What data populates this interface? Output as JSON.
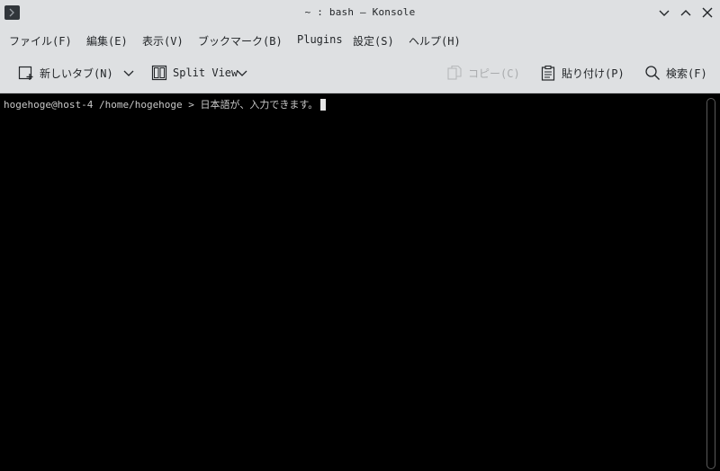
{
  "window": {
    "title": "~ : bash — Konsole",
    "app_icon": "terminal-icon",
    "controls": [
      "minimize-icon",
      "maximize-icon",
      "close-icon"
    ]
  },
  "menubar": {
    "items": [
      {
        "label": "ファイル(F)"
      },
      {
        "label": "編集(E)"
      },
      {
        "label": "表示(V)"
      },
      {
        "label": "ブックマーク(B)"
      },
      {
        "label": "Plugins"
      },
      {
        "label": "設定(S)"
      },
      {
        "label": "ヘルプ(H)"
      }
    ]
  },
  "toolbar": {
    "new_tab_label": "新しいタブ(N)",
    "split_view_label": "Split View",
    "copy_label": "コピー(C)",
    "paste_label": "貼り付け(P)",
    "find_label": "検索(F)"
  },
  "terminal": {
    "prompt": "hogehoge@host-4 /home/hogehoge > 日本語が、入力できます。"
  },
  "colors": {
    "chrome_bg": "#dee0e2",
    "terminal_bg": "#000000",
    "terminal_fg": "#c8c8c8"
  }
}
